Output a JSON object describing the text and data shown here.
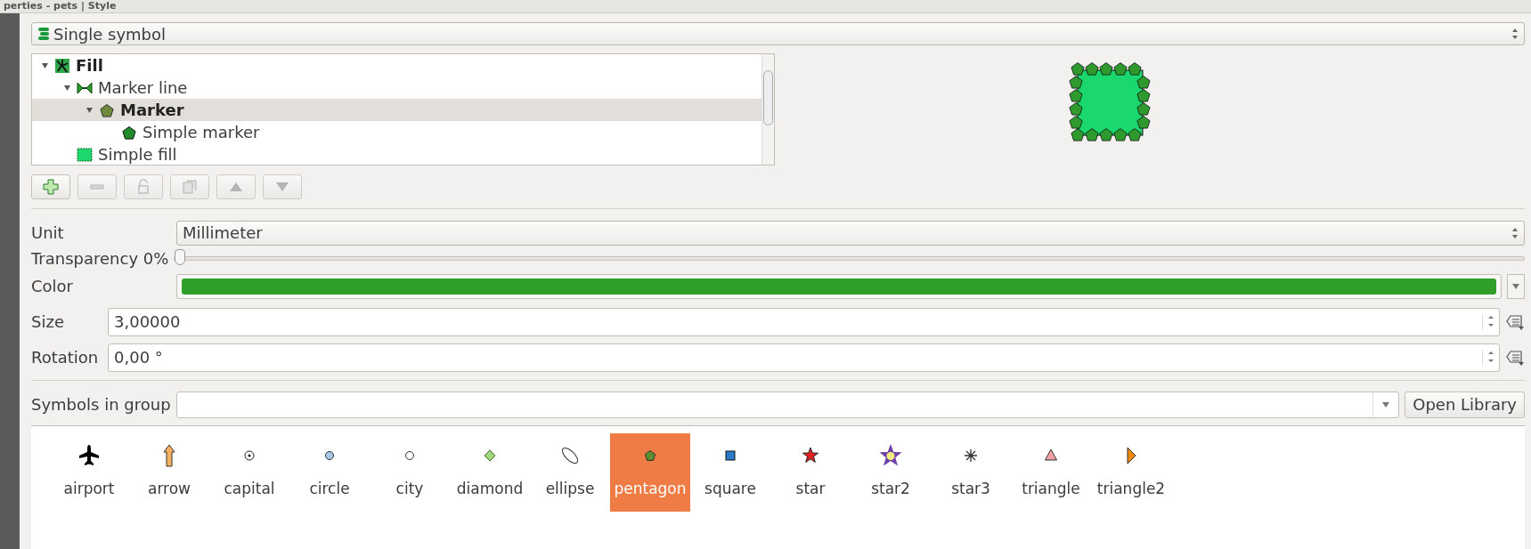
{
  "window": {
    "title": "perties - pets | Style"
  },
  "renderer": {
    "value": "Single symbol"
  },
  "tree": [
    {
      "label": "Fill",
      "kind": "fill",
      "expanded": true,
      "selected": false,
      "children": [
        {
          "label": "Marker line",
          "kind": "markerline",
          "expanded": true,
          "selected": false,
          "children": [
            {
              "label": "Marker",
              "kind": "marker",
              "expanded": true,
              "selected": true,
              "children": [
                {
                  "label": "Simple marker",
                  "kind": "simplemarker",
                  "selected": false
                }
              ]
            }
          ]
        },
        {
          "label": "Simple fill",
          "kind": "simplefill",
          "selected": false
        }
      ]
    }
  ],
  "toolbar": [
    {
      "kind": "add",
      "disabled": false
    },
    {
      "kind": "remove",
      "disabled": true
    },
    {
      "kind": "lock",
      "disabled": true
    },
    {
      "kind": "duplicate",
      "disabled": true
    },
    {
      "kind": "up",
      "disabled": true
    },
    {
      "kind": "down",
      "disabled": true
    }
  ],
  "unit": {
    "label": "Unit",
    "value": "Millimeter"
  },
  "transparency": {
    "label": "Transparency 0%",
    "level": 0
  },
  "color": {
    "label": "Color",
    "color": "#2f9f2a"
  },
  "size": {
    "label": "Size",
    "value": "3,00000"
  },
  "rotation": {
    "label": "Rotation",
    "value": "0,00 °"
  },
  "group": {
    "label": "Symbols in group",
    "button": "Open Library"
  },
  "symbols": [
    {
      "name": "airport",
      "kind": "airport",
      "selected": false
    },
    {
      "name": "arrow",
      "kind": "arrow",
      "selected": false
    },
    {
      "name": "capital",
      "kind": "capital",
      "selected": false
    },
    {
      "name": "circle",
      "kind": "circle",
      "selected": false
    },
    {
      "name": "city",
      "kind": "city",
      "selected": false
    },
    {
      "name": "diamond",
      "kind": "diamond",
      "selected": false
    },
    {
      "name": "ellipse",
      "kind": "ellipse",
      "selected": false
    },
    {
      "name": "pentagon",
      "kind": "pentagon",
      "selected": true
    },
    {
      "name": "square",
      "kind": "square",
      "selected": false
    },
    {
      "name": "star",
      "kind": "star",
      "selected": false
    },
    {
      "name": "star2",
      "kind": "star2",
      "selected": false
    },
    {
      "name": "star3",
      "kind": "star3",
      "selected": false
    },
    {
      "name": "triangle",
      "kind": "triangle",
      "selected": false
    },
    {
      "name": "triangle2",
      "kind": "triangle2",
      "selected": false
    }
  ]
}
